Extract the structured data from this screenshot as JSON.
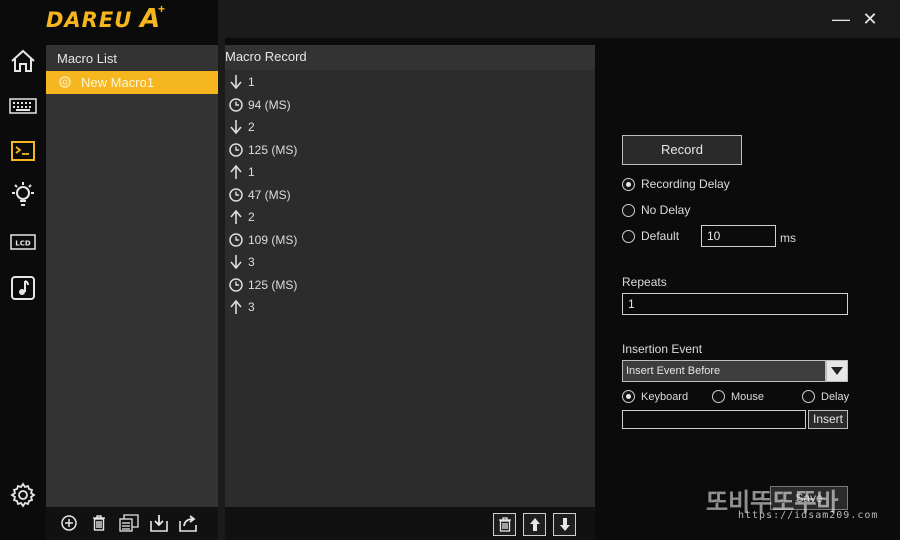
{
  "app": {
    "logo_text": "DAREU",
    "logo_mark": "A",
    "logo_plus": "+",
    "window_min": "—",
    "window_close": "✕",
    "accent_color": "#f5b61f"
  },
  "sidebar": {
    "items": [
      {
        "name": "home-icon"
      },
      {
        "name": "keyboard-icon"
      },
      {
        "name": "macro-terminal-icon",
        "active": true
      },
      {
        "name": "lightbulb-icon"
      },
      {
        "name": "lcd-icon",
        "label": "LCD"
      },
      {
        "name": "music-note-icon"
      },
      {
        "name": "gear-icon"
      }
    ]
  },
  "macro_list": {
    "title": "Macro List",
    "items": [
      {
        "label": "New Macro1",
        "selected": true
      }
    ],
    "toolbar": [
      "add-icon",
      "trash-icon",
      "copy-icon",
      "import-icon",
      "export-icon"
    ]
  },
  "macro_record": {
    "title": "Macro Record",
    "events": [
      {
        "type": "down",
        "icon": "arrow-down-icon",
        "text": "1"
      },
      {
        "type": "delay",
        "icon": "clock-icon",
        "text": "94 (MS)"
      },
      {
        "type": "down",
        "icon": "arrow-down-icon",
        "text": "2"
      },
      {
        "type": "delay",
        "icon": "clock-icon",
        "text": "125 (MS)"
      },
      {
        "type": "up",
        "icon": "arrow-up-icon",
        "text": "1"
      },
      {
        "type": "delay",
        "icon": "clock-icon",
        "text": "47 (MS)"
      },
      {
        "type": "up",
        "icon": "arrow-up-icon",
        "text": "2"
      },
      {
        "type": "delay",
        "icon": "clock-icon",
        "text": "109 (MS)"
      },
      {
        "type": "down",
        "icon": "arrow-down-icon",
        "text": "3"
      },
      {
        "type": "delay",
        "icon": "clock-icon",
        "text": "125 (MS)"
      },
      {
        "type": "up",
        "icon": "arrow-up-icon",
        "text": "3"
      }
    ],
    "toolbar": [
      "trash-icon",
      "move-up-icon",
      "move-down-icon"
    ]
  },
  "settings": {
    "record_label": "Record",
    "delay_options": [
      {
        "label": "Recording Delay",
        "selected": true
      },
      {
        "label": "No Delay",
        "selected": false
      },
      {
        "label": "Default",
        "selected": false
      }
    ],
    "default_delay_value": "10",
    "default_delay_unit": "ms",
    "repeats_label": "Repeats",
    "repeats_value": "1",
    "insertion_label": "Insertion Event",
    "insertion_selected": "Insert Event Before",
    "insertion_types": [
      {
        "label": "Keyboard",
        "selected": true
      },
      {
        "label": "Mouse",
        "selected": false
      },
      {
        "label": "Delay",
        "selected": false
      }
    ],
    "insert_value": "",
    "insert_label": "Insert",
    "save_label": "Save"
  },
  "watermark": {
    "title": "또비뚜또뚜바",
    "url": "https://idsam209.com"
  }
}
